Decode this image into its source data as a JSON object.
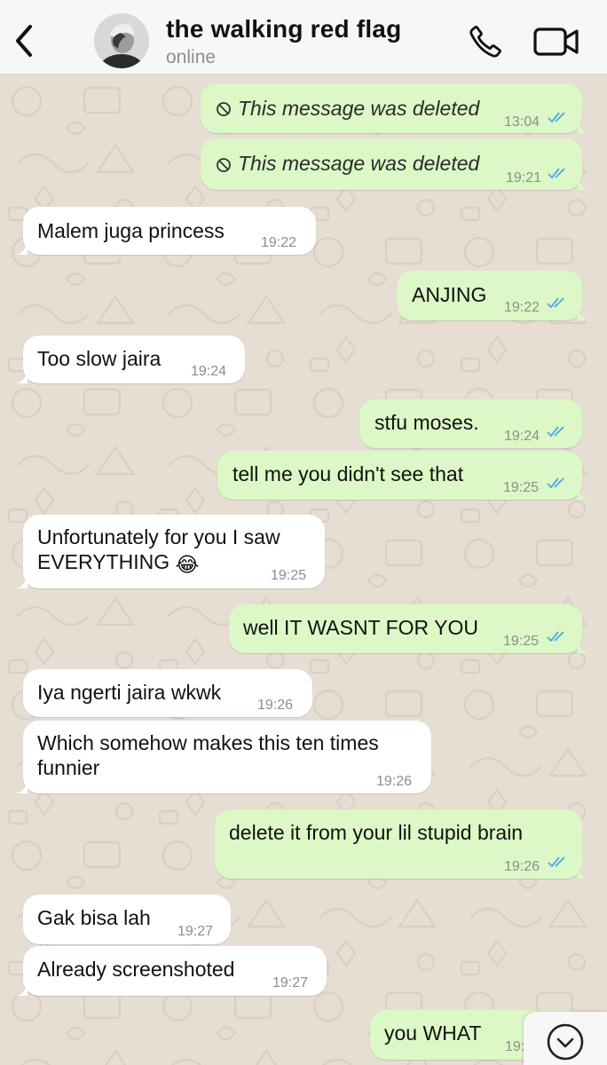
{
  "header": {
    "contact_name": "the walking red flag",
    "status": "online",
    "back_icon": "chevron-left-icon",
    "call_icon": "phone-icon",
    "video_icon": "video-camera-icon"
  },
  "colors": {
    "outgoing_bubble": "#dcf8c6",
    "incoming_bubble": "#ffffff",
    "read_ticks": "#4fa9e6",
    "wallpaper": "#e6ddd3"
  },
  "messages": [
    {
      "dir": "out",
      "text": "This message was deleted",
      "time": "13:04",
      "deleted": true
    },
    {
      "dir": "out",
      "text": "This message was deleted",
      "time": "19:21",
      "deleted": true
    },
    {
      "dir": "in",
      "text": "Malem juga princess",
      "time": "19:22"
    },
    {
      "dir": "out",
      "text": "ANJING",
      "time": "19:22"
    },
    {
      "dir": "in",
      "text": "Too slow jaira",
      "time": "19:24"
    },
    {
      "dir": "out",
      "text": "stfu moses.",
      "time": "19:24"
    },
    {
      "dir": "out",
      "text": "tell me you didn't see that",
      "time": "19:25"
    },
    {
      "dir": "in",
      "text_line1": "Unfortunately for you I saw",
      "text_line2": "EVERYTHING",
      "emoji": "😂",
      "time": "19:25"
    },
    {
      "dir": "out",
      "text": "well IT WASNT FOR YOU",
      "time": "19:25"
    },
    {
      "dir": "in",
      "text": "Iya ngerti jaira wkwk",
      "time": "19:26"
    },
    {
      "dir": "in",
      "text_line1": "Which somehow makes this ten times",
      "text_line2": "funnier",
      "time": "19:26"
    },
    {
      "dir": "out",
      "text": "delete it from your lil stupid brain",
      "time": "19:26"
    },
    {
      "dir": "in",
      "text": "Gak bisa lah",
      "time": "19:27"
    },
    {
      "dir": "in",
      "text": "Already screenshoted",
      "time": "19:27"
    },
    {
      "dir": "out",
      "text": "you WHAT",
      "time": "19:"
    }
  ],
  "scroll_button": {
    "icon": "chevron-down-icon"
  }
}
